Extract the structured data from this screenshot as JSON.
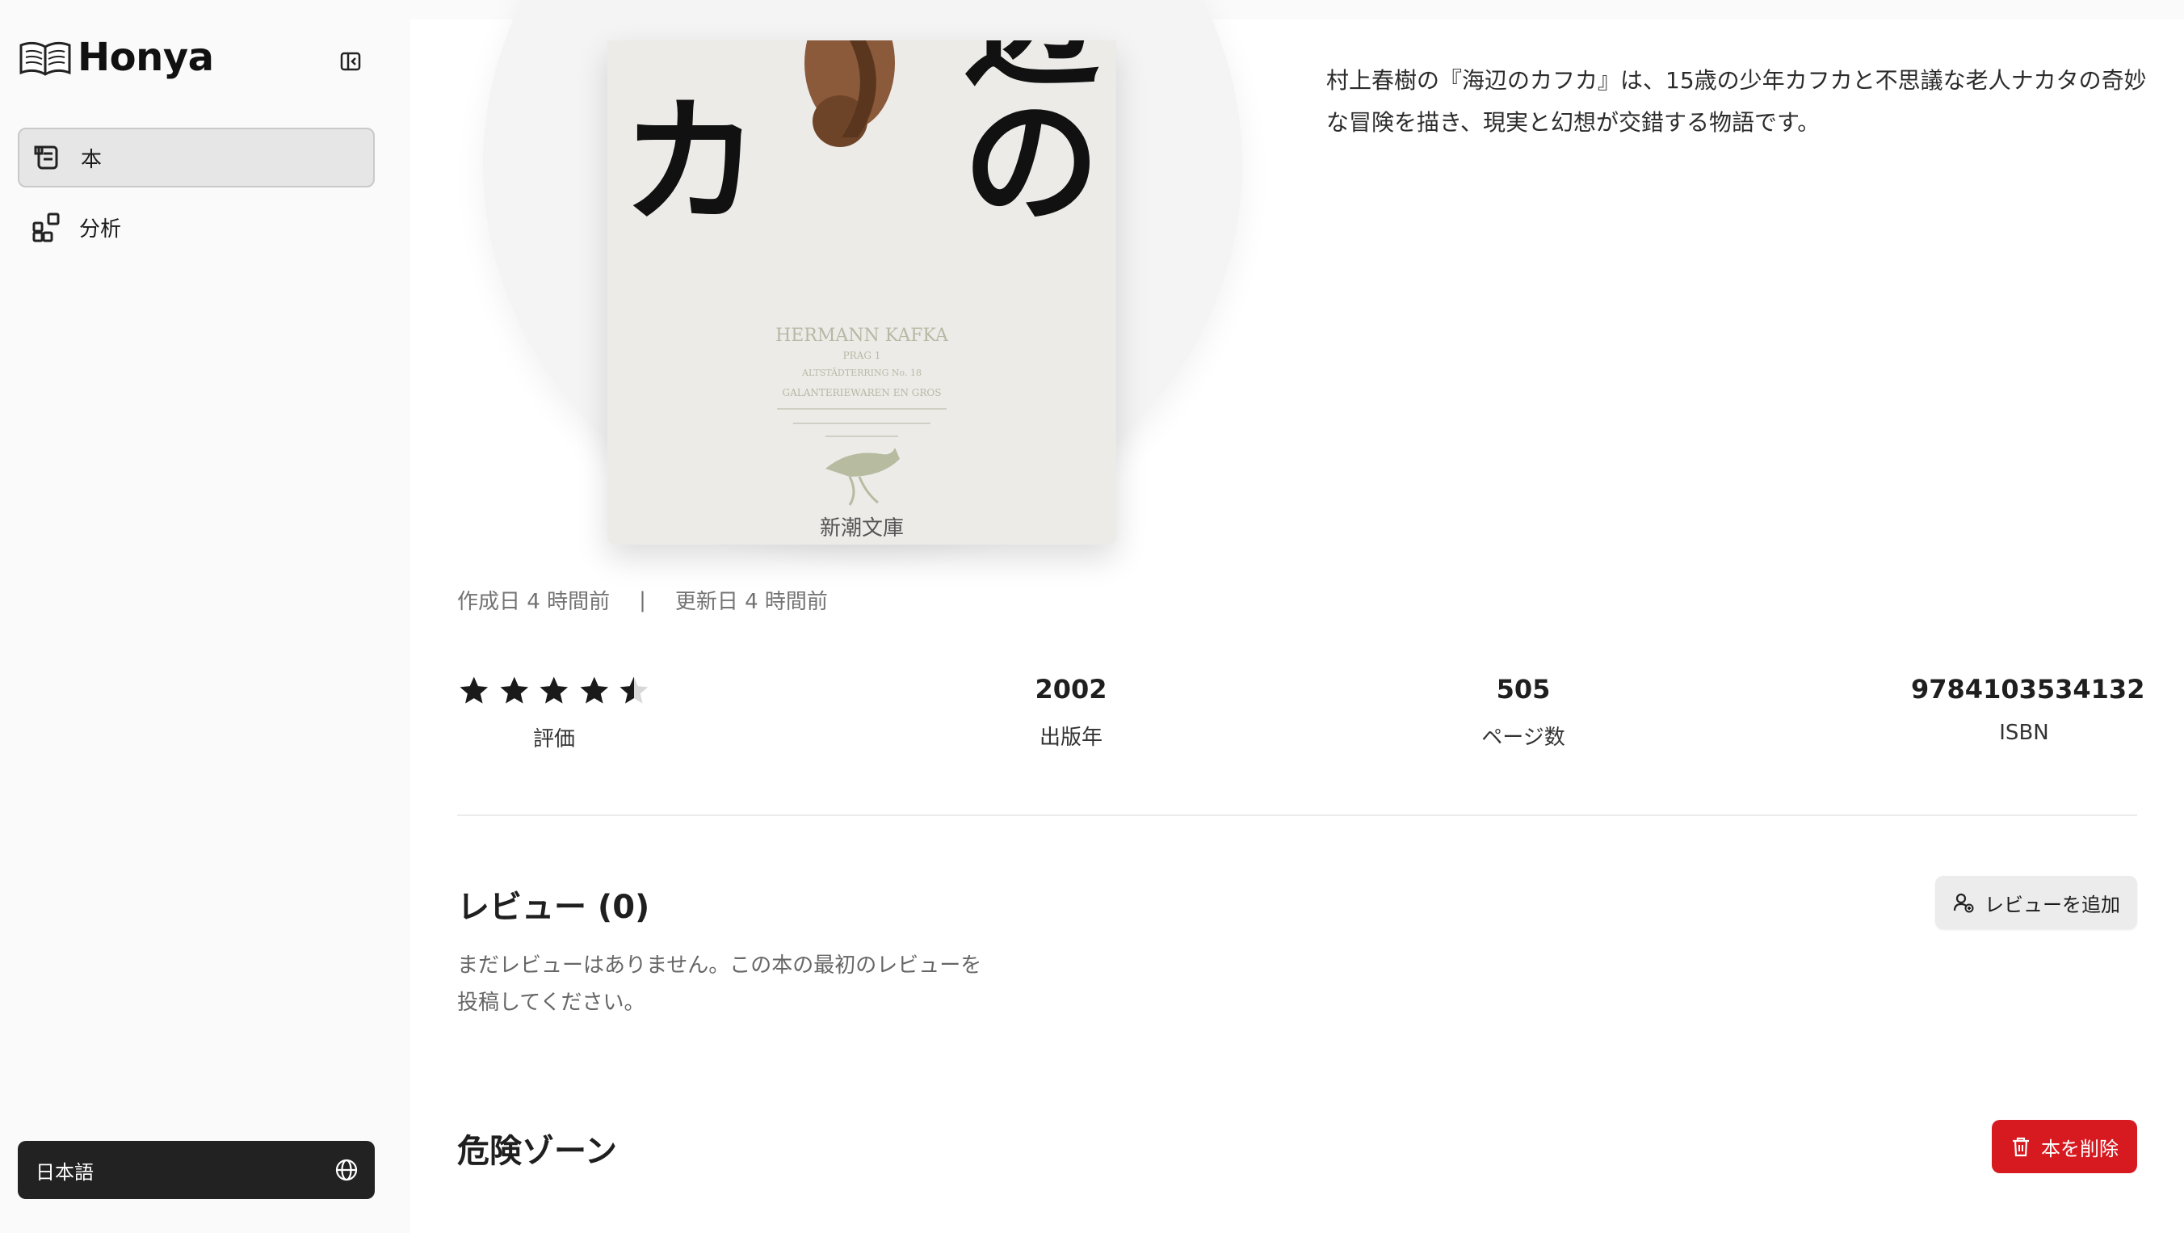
{
  "app": {
    "name": "Honya"
  },
  "sidebar": {
    "items": [
      {
        "label": "本",
        "icon": "book-scroll-icon",
        "active": true
      },
      {
        "label": "分析",
        "icon": "analytics-blocks-icon",
        "active": false
      }
    ],
    "language_label": "日本語"
  },
  "book": {
    "description": "村上春樹の『海辺のカフカ』は、15歳の少年カフカと不思議な老人ナカタの奇妙な冒険を描き、現実と幻想が交錯する物語です。",
    "cover": {
      "title_chars_left": "ン\nカ",
      "title_chars_right": "辺\nの",
      "sign_line1": "HERMANN KAFKA",
      "sign_line2": "PRAG 1",
      "sign_line3": "ALTSTÄDTERRING No. 18",
      "sign_line4": "GALANTERIEWAREN EN GROS",
      "publisher": "新潮文庫"
    },
    "created": "作成日 4 時間前",
    "separator": "|",
    "updated": "更新日 4 時間前",
    "rating": {
      "value": 4.5,
      "max": 5,
      "label": "評価"
    },
    "year": {
      "value": "2002",
      "label": "出版年"
    },
    "pages": {
      "value": "505",
      "label": "ページ数"
    },
    "isbn": {
      "value": "9784103534132",
      "label": "ISBN"
    }
  },
  "reviews": {
    "title": "レビュー (0)",
    "empty_text": "まだレビューはありません。この本の最初のレビューを投稿してください。",
    "add_button": "レビューを追加"
  },
  "danger": {
    "title": "危険ゾーン",
    "delete_button": "本を削除"
  },
  "colors": {
    "danger": "#d71920",
    "lang_button": "#222222",
    "active_nav": "#e6e6e6"
  }
}
